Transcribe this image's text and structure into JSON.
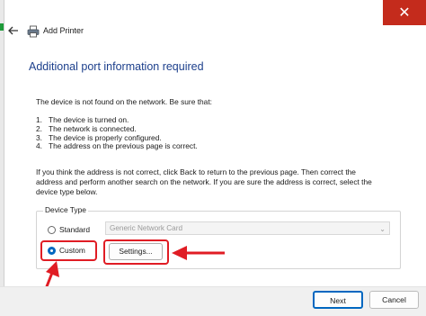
{
  "window": {
    "title": "Add Printer",
    "close_glyph": "✕"
  },
  "heading": "Additional port information required",
  "intro": "The device is not found on the network.  Be sure that:",
  "checklist": [
    {
      "num": "1.",
      "text": "The device is turned on."
    },
    {
      "num": "2.",
      "text": "The network is connected."
    },
    {
      "num": "3.",
      "text": "The device is properly configured."
    },
    {
      "num": "4.",
      "text": "The address on the previous page is correct."
    }
  ],
  "instructions": [
    "If you think the address is not correct, click Back to return to the previous page.  Then correct the",
    "address and perform another search on the network.  If you are sure the address is correct, select the",
    "device type below."
  ],
  "device_type": {
    "group_label": "Device Type",
    "standard_label": "Standard",
    "standard_selected": false,
    "standard_value": "Generic Network Card",
    "custom_label": "Custom",
    "custom_selected": true,
    "settings_label": "Settings..."
  },
  "footer": {
    "next_label": "Next",
    "cancel_label": "Cancel"
  },
  "colors": {
    "accent": "#0067c0",
    "annotation_red": "#e01c24",
    "heading_blue": "#1c3f8c"
  }
}
